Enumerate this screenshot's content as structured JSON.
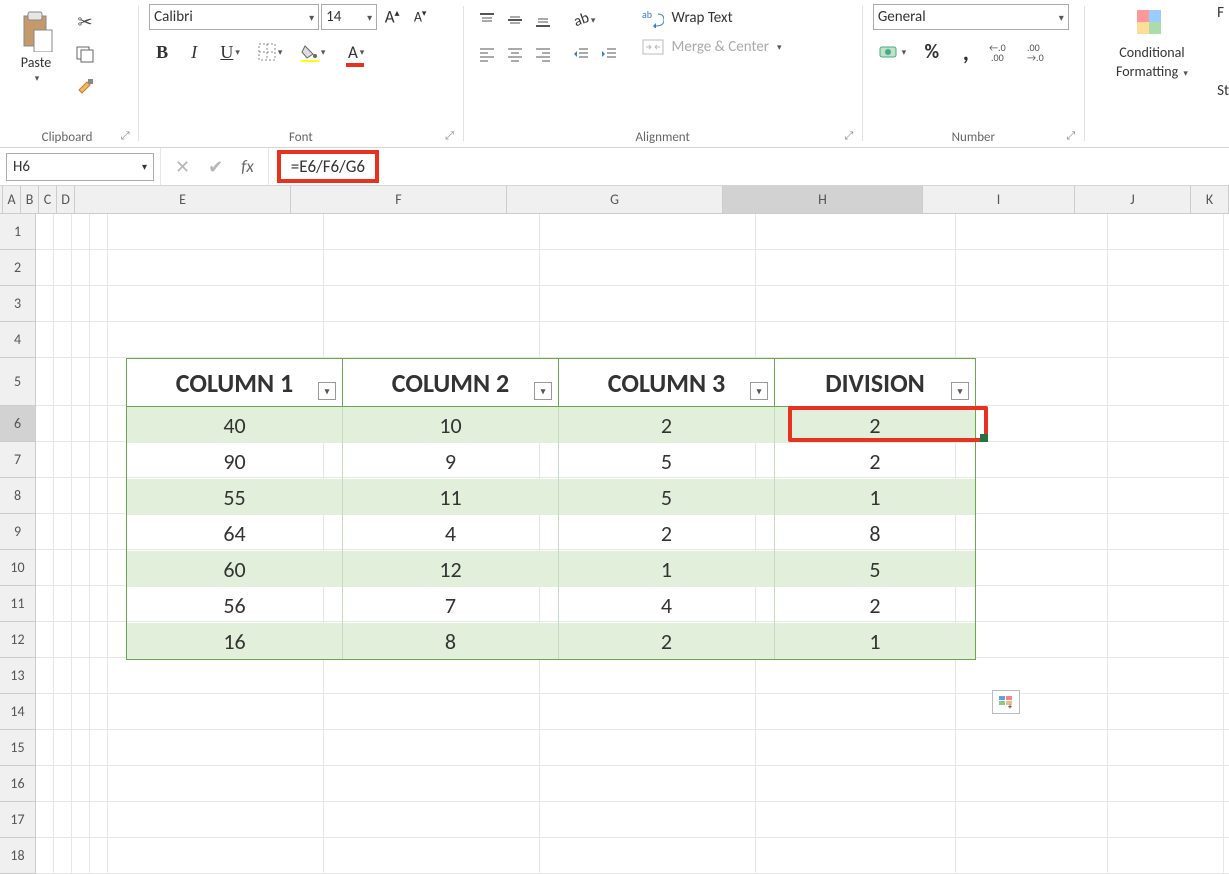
{
  "ribbon": {
    "clipboard": {
      "paste": "Paste",
      "label": "Clipboard"
    },
    "font": {
      "name": "Calibri",
      "size": "14",
      "bold": "B",
      "italic": "I",
      "underline": "U",
      "label": "Font"
    },
    "alignment": {
      "wrap": "Wrap Text",
      "merge": "Merge & Center",
      "label": "Alignment"
    },
    "number": {
      "format": "General",
      "pct": "%",
      "comma": ",",
      "label": "Number"
    },
    "styles": {
      "cond": "Conditional",
      "cond2": "Formatting",
      "fmt": "F",
      "st": "St"
    }
  },
  "formula_bar": {
    "name_box": "H6",
    "fx": "fx",
    "formula": "=E6/F6/G6"
  },
  "columns": [
    "A",
    "B",
    "C",
    "D",
    "E",
    "F",
    "G",
    "H",
    "I",
    "J",
    "K"
  ],
  "rows": [
    "1",
    "2",
    "3",
    "4",
    "5",
    "6",
    "7",
    "8",
    "9",
    "10",
    "11",
    "12",
    "13",
    "14",
    "15",
    "16",
    "17",
    "18"
  ],
  "active_col": "H",
  "active_row": "6",
  "table": {
    "headers": [
      "COLUMN 1",
      "COLUMN 2",
      "COLUMN 3",
      "DIVISION"
    ],
    "data": [
      [
        "40",
        "10",
        "2",
        "2"
      ],
      [
        "90",
        "9",
        "5",
        "2"
      ],
      [
        "55",
        "11",
        "5",
        "1"
      ],
      [
        "64",
        "4",
        "2",
        "8"
      ],
      [
        "60",
        "12",
        "1",
        "5"
      ],
      [
        "56",
        "7",
        "4",
        "2"
      ],
      [
        "16",
        "8",
        "2",
        "1"
      ]
    ]
  }
}
